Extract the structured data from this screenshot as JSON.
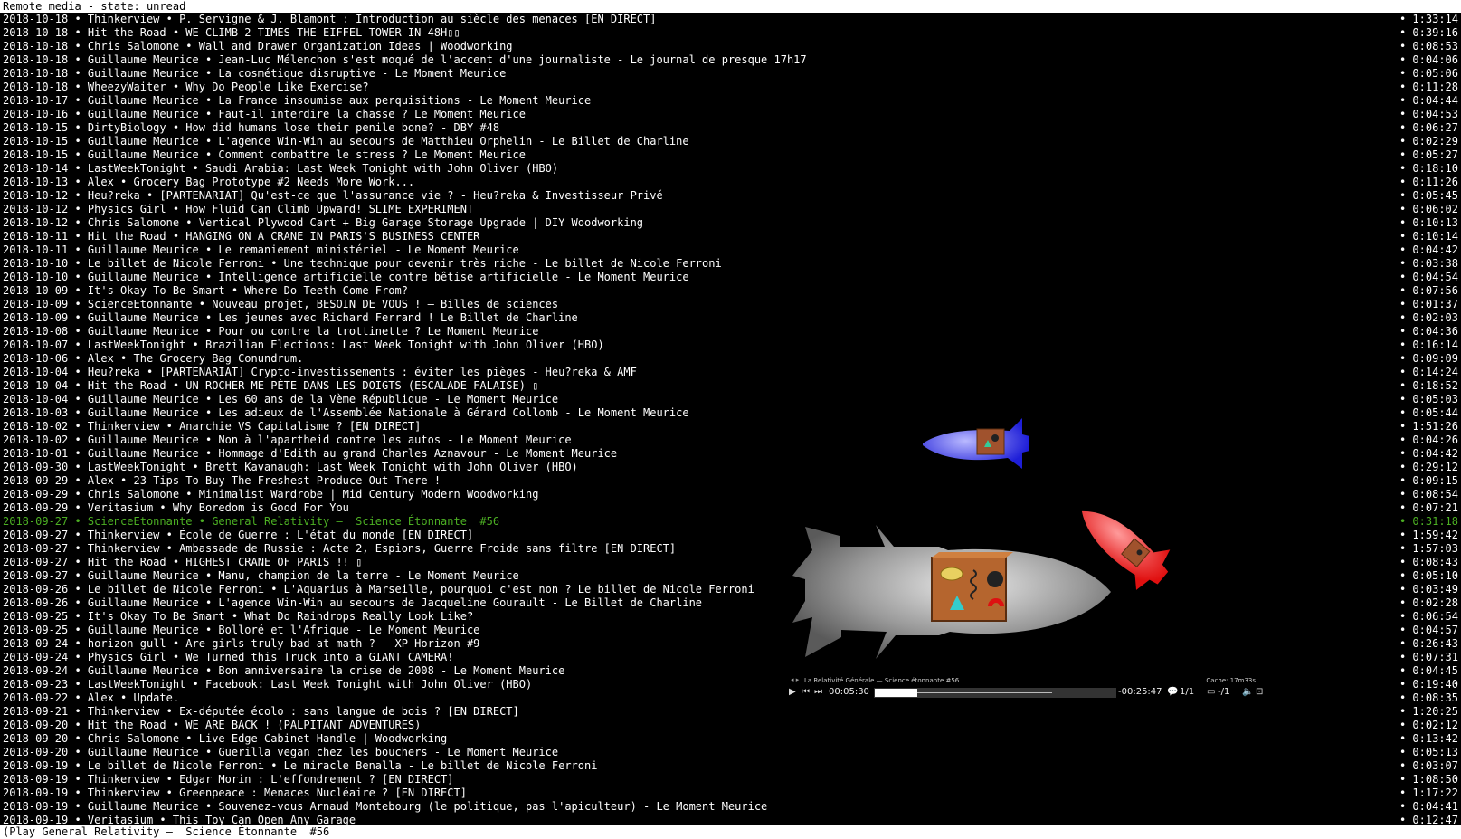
{
  "title_bar": "Remote media - state: unread",
  "status_bar": "(Play General Relativity —  Science Étonnante  #56",
  "bullet": "•",
  "highlight_index": 37,
  "rows": [
    {
      "date": "2018-10-18",
      "channel": "Thinkerview",
      "title": "P. Servigne & J. Blamont : Introduction au siècle des menaces [EN DIRECT]",
      "duration": "1:33:14"
    },
    {
      "date": "2018-10-18",
      "channel": "Hit the Road",
      "title": "WE CLIMB 2 TIMES THE EIFFEL TOWER IN 48H▯▯",
      "duration": "0:39:16"
    },
    {
      "date": "2018-10-18",
      "channel": "Chris Salomone",
      "title": "Wall and Drawer Organization Ideas | Woodworking",
      "duration": "0:08:53"
    },
    {
      "date": "2018-10-18",
      "channel": "Guillaume Meurice",
      "title": "Jean-Luc Mélenchon s'est moqué de l'accent d'une journaliste - Le journal de presque 17h17",
      "duration": "0:04:06"
    },
    {
      "date": "2018-10-18",
      "channel": "Guillaume Meurice",
      "title": "La cosmétique disruptive - Le Moment Meurice",
      "duration": "0:05:06"
    },
    {
      "date": "2018-10-18",
      "channel": "WheezyWaiter",
      "title": "Why Do People Like Exercise?",
      "duration": "0:11:28"
    },
    {
      "date": "2018-10-17",
      "channel": "Guillaume Meurice",
      "title": "La France insoumise aux perquisitions - Le Moment Meurice",
      "duration": "0:04:44"
    },
    {
      "date": "2018-10-16",
      "channel": "Guillaume Meurice",
      "title": "Faut-il interdire la chasse ? Le Moment Meurice",
      "duration": "0:04:53"
    },
    {
      "date": "2018-10-15",
      "channel": "DirtyBiology",
      "title": "How did humans lose their penile bone? - DBY #48",
      "duration": "0:06:27"
    },
    {
      "date": "2018-10-15",
      "channel": "Guillaume Meurice",
      "title": "L'agence Win-Win au secours de Matthieu Orphelin - Le Billet de Charline",
      "duration": "0:02:29"
    },
    {
      "date": "2018-10-15",
      "channel": "Guillaume Meurice",
      "title": "Comment combattre le stress ? Le Moment Meurice",
      "duration": "0:05:27"
    },
    {
      "date": "2018-10-14",
      "channel": "LastWeekTonight",
      "title": "Saudi Arabia: Last Week Tonight with John Oliver (HBO)",
      "duration": "0:18:10"
    },
    {
      "date": "2018-10-13",
      "channel": "Alex",
      "title": "Grocery Bag Prototype #2 Needs More Work...",
      "duration": "0:11:26"
    },
    {
      "date": "2018-10-12",
      "channel": "Heu?reka",
      "title": "[PARTENARIAT] Qu'est-ce que l'assurance vie ? - Heu?reka & Investisseur Privé",
      "duration": "0:05:45"
    },
    {
      "date": "2018-10-12",
      "channel": "Physics Girl",
      "title": "How Fluid Can Climb Upward! SLIME EXPERIMENT",
      "duration": "0:06:02"
    },
    {
      "date": "2018-10-12",
      "channel": "Chris Salomone",
      "title": "Vertical Plywood Cart + Big Garage Storage Upgrade | DIY Woodworking",
      "duration": "0:10:13"
    },
    {
      "date": "2018-10-11",
      "channel": "Hit the Road",
      "title": "HANGING ON A CRANE IN PARIS'S BUSINESS CENTER",
      "duration": "0:10:14"
    },
    {
      "date": "2018-10-11",
      "channel": "Guillaume Meurice",
      "title": "Le remaniement ministériel - Le Moment Meurice",
      "duration": "0:04:42"
    },
    {
      "date": "2018-10-10",
      "channel": "Le billet de Nicole Ferroni",
      "title": "Une technique pour devenir très riche - Le billet de Nicole Ferroni",
      "duration": "0:03:38"
    },
    {
      "date": "2018-10-10",
      "channel": "Guillaume Meurice",
      "title": "Intelligence artificielle contre bêtise artificielle - Le Moment Meurice",
      "duration": "0:04:54"
    },
    {
      "date": "2018-10-09",
      "channel": "It's Okay To Be Smart",
      "title": "Where Do Teeth Come From?",
      "duration": "0:07:56"
    },
    {
      "date": "2018-10-09",
      "channel": "ScienceEtonnante",
      "title": "Nouveau projet, BESOIN DE VOUS ! — Billes de sciences",
      "duration": "0:01:37"
    },
    {
      "date": "2018-10-09",
      "channel": "Guillaume Meurice",
      "title": "Les jeunes avec Richard Ferrand ! Le Billet de Charline",
      "duration": "0:02:03"
    },
    {
      "date": "2018-10-08",
      "channel": "Guillaume Meurice",
      "title": "Pour ou contre la trottinette ? Le Moment Meurice",
      "duration": "0:04:36"
    },
    {
      "date": "2018-10-07",
      "channel": "LastWeekTonight",
      "title": "Brazilian Elections: Last Week Tonight with John Oliver (HBO)",
      "duration": "0:16:14"
    },
    {
      "date": "2018-10-06",
      "channel": "Alex",
      "title": "The Grocery Bag Conundrum.",
      "duration": "0:09:09"
    },
    {
      "date": "2018-10-04",
      "channel": "Heu?reka",
      "title": "[PARTENARIAT] Crypto-investissements : éviter les pièges - Heu?reka & AMF",
      "duration": "0:14:24"
    },
    {
      "date": "2018-10-04",
      "channel": "Hit the Road",
      "title": "UN ROCHER ME PÈTE DANS LES DOIGTS (ESCALADE FALAISE) ▯",
      "duration": "0:18:52"
    },
    {
      "date": "2018-10-04",
      "channel": "Guillaume Meurice",
      "title": "Les 60 ans de la Vème République - Le Moment Meurice",
      "duration": "0:05:03"
    },
    {
      "date": "2018-10-03",
      "channel": "Guillaume Meurice",
      "title": "Les adieux de l'Assemblée Nationale à Gérard Collomb - Le Moment Meurice",
      "duration": "0:05:44"
    },
    {
      "date": "2018-10-02",
      "channel": "Thinkerview",
      "title": "Anarchie VS Capitalisme ? [EN DIRECT]",
      "duration": "1:51:26"
    },
    {
      "date": "2018-10-02",
      "channel": "Guillaume Meurice",
      "title": "Non à l'apartheid contre les autos - Le Moment Meurice",
      "duration": "0:04:26"
    },
    {
      "date": "2018-10-01",
      "channel": "Guillaume Meurice",
      "title": "Hommage d'Edith au grand Charles Aznavour - Le Moment Meurice",
      "duration": "0:04:42"
    },
    {
      "date": "2018-09-30",
      "channel": "LastWeekTonight",
      "title": "Brett Kavanaugh: Last Week Tonight with John Oliver (HBO)",
      "duration": "0:29:12"
    },
    {
      "date": "2018-09-29",
      "channel": "Alex",
      "title": "23 Tips To Buy The Freshest Produce Out There !",
      "duration": "0:09:15"
    },
    {
      "date": "2018-09-29",
      "channel": "Chris Salomone",
      "title": "Minimalist Wardrobe | Mid Century Modern Woodworking",
      "duration": "0:08:54"
    },
    {
      "date": "2018-09-29",
      "channel": "Veritasium",
      "title": "Why Boredom is Good For You",
      "duration": "0:07:21"
    },
    {
      "date": "2018-09-27",
      "channel": "ScienceEtonnante",
      "title": "General Relativity —  Science Étonnante  #56",
      "duration": "0:31:18"
    },
    {
      "date": "2018-09-27",
      "channel": "Thinkerview",
      "title": "École de Guerre : L'état du monde [EN DIRECT]",
      "duration": "1:59:42"
    },
    {
      "date": "2018-09-27",
      "channel": "Thinkerview",
      "title": "Ambassade de Russie : Acte 2, Espions, Guerre Froide sans filtre [EN DIRECT]",
      "duration": "1:57:03"
    },
    {
      "date": "2018-09-27",
      "channel": "Hit the Road",
      "title": "HIGHEST CRANE OF PARIS !! ▯",
      "duration": "0:08:43"
    },
    {
      "date": "2018-09-27",
      "channel": "Guillaume Meurice",
      "title": "Manu, champion de la terre - Le Moment Meurice",
      "duration": "0:05:10"
    },
    {
      "date": "2018-09-26",
      "channel": "Le billet de Nicole Ferroni",
      "title": "L'Aquarius à Marseille, pourquoi c'est non ? Le billet de Nicole Ferroni",
      "duration": "0:03:49"
    },
    {
      "date": "2018-09-26",
      "channel": "Guillaume Meurice",
      "title": "L'agence Win-Win au secours de Jacqueline Gourault - Le Billet de Charline",
      "duration": "0:02:28"
    },
    {
      "date": "2018-09-25",
      "channel": "It's Okay To Be Smart",
      "title": "What Do Raindrops Really Look Like?",
      "duration": "0:06:54"
    },
    {
      "date": "2018-09-25",
      "channel": "Guillaume Meurice",
      "title": "Bolloré et l'Afrique - Le Moment Meurice",
      "duration": "0:04:57"
    },
    {
      "date": "2018-09-24",
      "channel": "horizon-gull",
      "title": "Are girls truly bad at math ? - XP Horizon #9",
      "duration": "0:26:43"
    },
    {
      "date": "2018-09-24",
      "channel": "Physics Girl",
      "title": "We Turned this Truck into a GIANT CAMERA!",
      "duration": "0:07:31"
    },
    {
      "date": "2018-09-24",
      "channel": "Guillaume Meurice",
      "title": "Bon anniversaire la crise de 2008 - Le Moment Meurice",
      "duration": "0:04:45"
    },
    {
      "date": "2018-09-23",
      "channel": "LastWeekTonight",
      "title": "Facebook: Last Week Tonight with John Oliver (HBO)",
      "duration": "0:19:40"
    },
    {
      "date": "2018-09-22",
      "channel": "Alex",
      "title": "Update.",
      "duration": "0:08:35"
    },
    {
      "date": "2018-09-21",
      "channel": "Thinkerview",
      "title": "Ex-députée écolo : sans langue de bois ? [EN DIRECT]",
      "duration": "1:20:25"
    },
    {
      "date": "2018-09-20",
      "channel": "Hit the Road",
      "title": "WE ARE BACK ! (PALPITANT ADVENTURES)",
      "duration": "0:02:12"
    },
    {
      "date": "2018-09-20",
      "channel": "Chris Salomone",
      "title": "Live Edge Cabinet Handle | Woodworking",
      "duration": "0:13:42"
    },
    {
      "date": "2018-09-20",
      "channel": "Guillaume Meurice",
      "title": "Guerilla vegan chez les bouchers - Le Moment Meurice",
      "duration": "0:05:13"
    },
    {
      "date": "2018-09-19",
      "channel": "Le billet de Nicole Ferroni",
      "title": "Le miracle Benalla - Le billet de Nicole Ferroni",
      "duration": "0:03:07"
    },
    {
      "date": "2018-09-19",
      "channel": "Thinkerview",
      "title": "Edgar Morin : L'effondrement ? [EN DIRECT]",
      "duration": "1:08:50"
    },
    {
      "date": "2018-09-19",
      "channel": "Thinkerview",
      "title": "Greenpeace : Menaces Nucléaire ? [EN DIRECT]",
      "duration": "1:17:22"
    },
    {
      "date": "2018-09-19",
      "channel": "Guillaume Meurice",
      "title": "Souvenez-vous Arnaud Montebourg (le politique, pas l'apiculteur) - Le Moment Meurice",
      "duration": "0:04:41"
    },
    {
      "date": "2018-09-19",
      "channel": "Veritasium",
      "title": "This Toy Can Open Any Garage",
      "duration": "0:12:47"
    }
  ],
  "player": {
    "media_title": "La Relativité Générale — Science étonnante #56",
    "cache": "Cache: 17m33s",
    "elapsed": "00:05:30",
    "remaining": "-00:25:47",
    "playlist_pos": "1/1",
    "subtitle_track": "-/1",
    "progress_percent": 17.5,
    "icons": [
      "prev-arrow-icon",
      "next-arrow-icon",
      "play-icon",
      "skip-back-icon",
      "skip-forward-icon",
      "chat-icon",
      "subtitles-icon",
      "volume-icon",
      "fullscreen-icon"
    ]
  },
  "colors": {
    "highlight": "#4caf23",
    "background": "#000000",
    "bar": "#ffffff"
  }
}
